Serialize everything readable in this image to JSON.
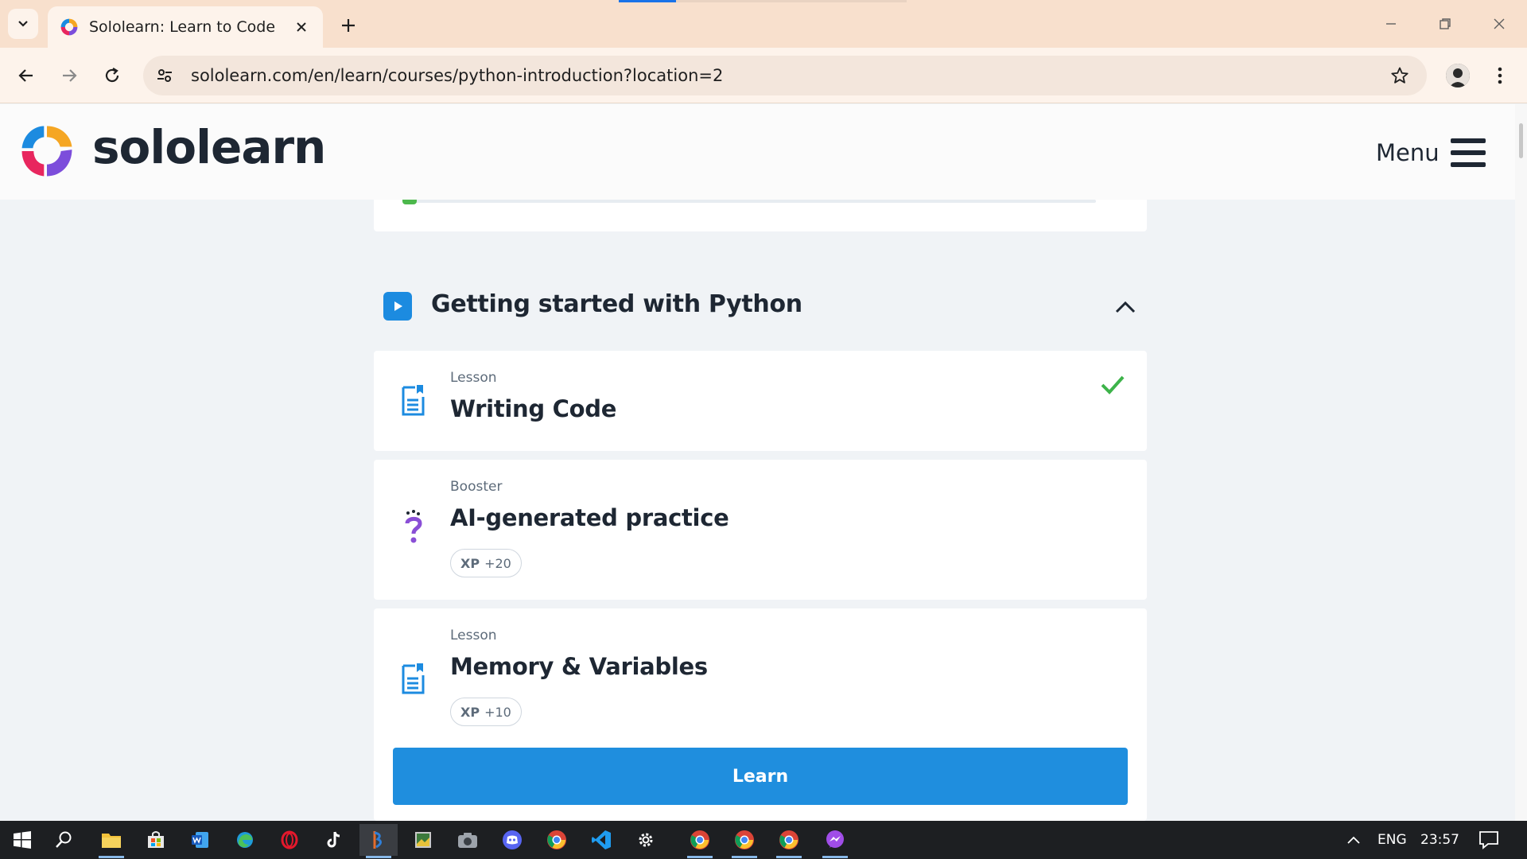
{
  "browser": {
    "tab_title": "Sololearn: Learn to Code",
    "url": "sololearn.com/en/learn/courses/python-introduction?location=2",
    "icons": {
      "tab_search": "chevron-down-icon",
      "close_tab": "close-icon",
      "new_tab": "plus-icon",
      "back": "arrow-left-icon",
      "forward": "arrow-right-icon",
      "reload": "reload-icon",
      "site_info": "tune-icon",
      "bookmark": "star-icon",
      "menu": "kebab-icon"
    }
  },
  "site": {
    "brand": "sololearn",
    "menu_label": "Menu"
  },
  "module": {
    "title": "Getting started with Python"
  },
  "items": [
    {
      "type": "Lesson",
      "title": "Writing Code",
      "completed": true
    },
    {
      "type": "Booster",
      "title": "AI-generated practice",
      "xp_label": "XP",
      "xp_value": "+20"
    },
    {
      "type": "Lesson",
      "title": "Memory & Variables",
      "xp_label": "XP",
      "xp_value": "+10"
    }
  ],
  "actions": {
    "learn_label": "Learn"
  },
  "colors": {
    "accent_blue": "#1f8ede",
    "complete_green": "#3db34a",
    "booster_purple": "#8a4fd6",
    "text_dark": "#1e2733"
  },
  "taskbar": {
    "language": "ENG",
    "time": "23:57"
  }
}
